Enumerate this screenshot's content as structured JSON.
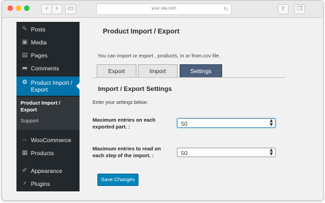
{
  "browser": {
    "url": "your site.com",
    "back_icon": "chevron-left",
    "forward_icon": "chevron-right",
    "reload_icon": "reload"
  },
  "sidebar": {
    "items": [
      {
        "label": "Posts",
        "icon": "pin-icon"
      },
      {
        "label": "Media",
        "icon": "media-icon"
      },
      {
        "label": "Pages",
        "icon": "pages-icon"
      },
      {
        "label": "Comments",
        "icon": "comments-icon"
      },
      {
        "label": "Product Import /\nExport",
        "icon": "gear-icon",
        "active": true
      },
      {
        "label": "WooCommerce",
        "icon": "woo-icon"
      },
      {
        "label": "Products",
        "icon": "products-icon"
      },
      {
        "label": "Appearance",
        "icon": "brush-icon"
      },
      {
        "label": "Plugins",
        "icon": "plugin-icon"
      }
    ],
    "submenu": [
      {
        "label": "Product Import /",
        "label2": "Export"
      },
      {
        "label": "Support"
      }
    ]
  },
  "main": {
    "title": "Product Import / Export",
    "intro": "You can import or export , products, in or from.csv file.",
    "tabs": [
      {
        "label": "Export"
      },
      {
        "label": "Import"
      },
      {
        "label": "Settings",
        "active": true
      }
    ],
    "settings_title": "Import / Export Settings",
    "settings_sub": "Enter your settings below:",
    "fields": [
      {
        "label_line1": "Maximum entries on each",
        "label_line2": "exported part.  :",
        "value": "50"
      },
      {
        "label_line1": "Maximum entries to read on",
        "label_line2": "each step of the import.  :",
        "value": "50"
      }
    ],
    "save_label": "Save Changes"
  },
  "colors": {
    "sidebar_bg": "#23282d",
    "active_bg": "#0073aa",
    "tab_active_bg": "#4e5f7d",
    "button_bg": "#0085ba"
  }
}
